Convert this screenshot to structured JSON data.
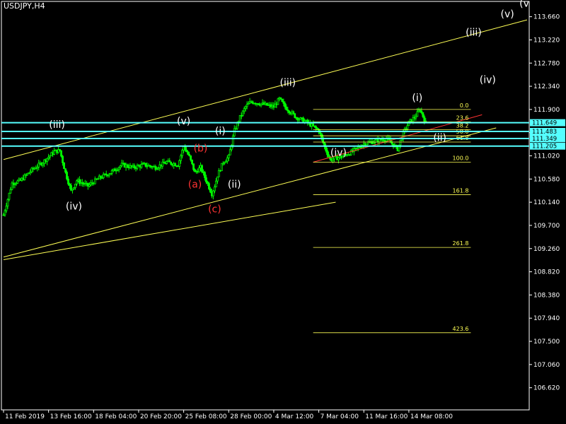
{
  "window": {
    "symbol_label": "USDJPY,H4"
  },
  "chart_data": {
    "type": "candlestick",
    "symbol": "USDJPY",
    "timeframe": "H4",
    "ylim": [
      106.2,
      113.95
    ],
    "y_ticks": [
      "113.660",
      "113.220",
      "112.780",
      "112.340",
      "111.900",
      "111.460",
      "111.020",
      "110.580",
      "110.140",
      "109.700",
      "109.260",
      "108.820",
      "108.380",
      "107.940",
      "107.500",
      "107.060",
      "106.620"
    ],
    "x_ticks": [
      {
        "label": "11 Feb 2019",
        "bar": 0
      },
      {
        "label": "13 Feb 16:00",
        "bar": 16
      },
      {
        "label": "18 Feb 04:00",
        "bar": 32
      },
      {
        "label": "20 Feb 20:00",
        "bar": 48
      },
      {
        "label": "25 Feb 08:00",
        "bar": 64
      },
      {
        "label": "28 Feb 00:00",
        "bar": 80
      },
      {
        "label": "4 Mar 12:00",
        "bar": 96
      },
      {
        "label": "7 Mar 04:00",
        "bar": 112
      },
      {
        "label": "11 Mar 16:00",
        "bar": 128
      },
      {
        "label": "14 Mar 08:00",
        "bar": 144
      }
    ],
    "x_range_bars": [
      0,
      186
    ],
    "price_path": [
      [
        0,
        109.9
      ],
      [
        3,
        110.5
      ],
      [
        6,
        110.55
      ],
      [
        10,
        110.75
      ],
      [
        14,
        110.9
      ],
      [
        18,
        111.1
      ],
      [
        20,
        111.12
      ],
      [
        22,
        110.7
      ],
      [
        24,
        110.35
      ],
      [
        26,
        110.55
      ],
      [
        30,
        110.45
      ],
      [
        34,
        110.6
      ],
      [
        38,
        110.7
      ],
      [
        42,
        110.85
      ],
      [
        46,
        110.8
      ],
      [
        50,
        110.85
      ],
      [
        54,
        110.8
      ],
      [
        58,
        110.9
      ],
      [
        62,
        110.85
      ],
      [
        64,
        111.2
      ],
      [
        66,
        111.0
      ],
      [
        68,
        110.7
      ],
      [
        70,
        110.8
      ],
      [
        72,
        110.55
      ],
      [
        74,
        110.3
      ],
      [
        75,
        110.45
      ],
      [
        76,
        110.65
      ],
      [
        78,
        110.9
      ],
      [
        80,
        111.0
      ],
      [
        82,
        111.5
      ],
      [
        84,
        111.75
      ],
      [
        86,
        111.95
      ],
      [
        88,
        112.05
      ],
      [
        92,
        112.0
      ],
      [
        96,
        111.95
      ],
      [
        98,
        112.1
      ],
      [
        100,
        111.95
      ],
      [
        104,
        111.75
      ],
      [
        108,
        111.65
      ],
      [
        112,
        111.5
      ],
      [
        114,
        111.2
      ],
      [
        116,
        110.95
      ],
      [
        120,
        111.0
      ],
      [
        124,
        111.1
      ],
      [
        128,
        111.25
      ],
      [
        132,
        111.3
      ],
      [
        136,
        111.35
      ],
      [
        140,
        111.15
      ],
      [
        142,
        111.45
      ],
      [
        144,
        111.65
      ],
      [
        146,
        111.75
      ],
      [
        148,
        111.9
      ],
      [
        150,
        111.65
      ]
    ],
    "horizontal_levels": [
      "111.649",
      "111.483",
      "111.349",
      "111.205"
    ],
    "fibonacci": {
      "price_0": 111.9,
      "price_100": 110.9,
      "start_bar": 110,
      "end_bar": 166,
      "levels": [
        {
          "ratio": 0.0,
          "label": "0.0"
        },
        {
          "ratio": 0.236,
          "label": "23.6"
        },
        {
          "ratio": 0.382,
          "label": "38.2"
        },
        {
          "ratio": 0.5,
          "label": "50.0"
        },
        {
          "ratio": 0.618,
          "label": "61.8"
        },
        {
          "ratio": 1.0,
          "label": "100.0"
        },
        {
          "ratio": 1.618,
          "label": "161.8"
        },
        {
          "ratio": 2.618,
          "label": "261.8"
        },
        {
          "ratio": 4.236,
          "label": "423.6"
        }
      ]
    },
    "trendlines": [
      {
        "from": [
          0,
          110.95
        ],
        "to": [
          186,
          113.6
        ],
        "color": "#ffff55"
      },
      {
        "from": [
          0,
          109.1
        ],
        "to": [
          175,
          111.55
        ],
        "color": "#ffff55"
      },
      {
        "from": [
          0,
          109.05
        ],
        "to": [
          118,
          110.14
        ],
        "color": "#ffff55"
      },
      {
        "from": [
          110,
          110.9
        ],
        "to": [
          170,
          111.8
        ],
        "color": "#ff3333"
      }
    ],
    "wave_labels": [
      {
        "text": "(iii)",
        "bar": 19,
        "price": 111.55,
        "color": "#ffffff"
      },
      {
        "text": "(iv)",
        "bar": 25,
        "price": 110.0,
        "color": "#ffffff"
      },
      {
        "text": "(v)",
        "bar": 64,
        "price": 111.62,
        "color": "#ffffff"
      },
      {
        "text": "(b)",
        "bar": 70,
        "price": 111.1,
        "color": "#ff3333"
      },
      {
        "text": "(a)",
        "bar": 68,
        "price": 110.42,
        "color": "#ff3333"
      },
      {
        "text": "(c)",
        "bar": 75,
        "price": 109.95,
        "color": "#ff3333"
      },
      {
        "text": "(i)",
        "bar": 77,
        "price": 111.43,
        "color": "#ffffff"
      },
      {
        "text": "(ii)",
        "bar": 82,
        "price": 110.42,
        "color": "#ffffff"
      },
      {
        "text": "(iii)",
        "bar": 101,
        "price": 112.35,
        "color": "#ffffff"
      },
      {
        "text": "(iv)",
        "bar": 119,
        "price": 111.02,
        "color": "#ffffff"
      },
      {
        "text": "(i)",
        "bar": 147,
        "price": 112.06,
        "color": "#ffffff"
      },
      {
        "text": "(ii)",
        "bar": 155,
        "price": 111.3,
        "color": "#ffffff"
      },
      {
        "text": "(iv)",
        "bar": 172,
        "price": 112.4,
        "color": "#ffffff"
      },
      {
        "text": "(iii)",
        "bar": 167,
        "price": 113.3,
        "color": "#ffffff"
      },
      {
        "text": "(v)",
        "bar": 179,
        "price": 113.65,
        "color": "#ffffff"
      },
      {
        "text": "(v",
        "bar": 185,
        "price": 113.85,
        "color": "#ffffff"
      }
    ],
    "colors": {
      "background": "#000000",
      "candle_up": "#00ff00",
      "candle_down": "#00ff00",
      "level_line": "#55ffff",
      "fib_line": "#ffff55",
      "fib_text": "#ffff55",
      "axis": "#ffffff"
    }
  }
}
